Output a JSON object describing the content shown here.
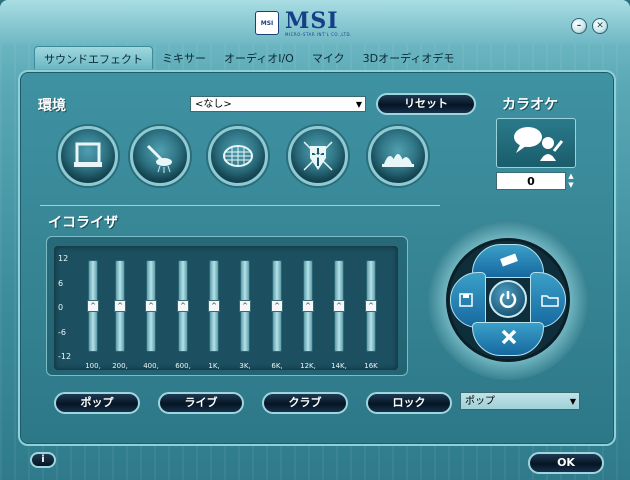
{
  "window": {
    "logo_main": "MSI",
    "logo_small": "MSI",
    "logo_sub": "MICRO-STAR INT'L CO.,LTD.",
    "minimize_label": "–",
    "close_label": "✕"
  },
  "tabs": [
    {
      "label": "サウンドエフェクト",
      "active": true
    },
    {
      "label": "ミキサー",
      "active": false
    },
    {
      "label": "オーディオI/O",
      "active": false
    },
    {
      "label": "マイク",
      "active": false
    },
    {
      "label": "3Dオーディオデモ",
      "active": false
    }
  ],
  "environment": {
    "label": "環境",
    "selected": "<なし>",
    "reset_label": "リセット",
    "icons": [
      "bathroom-icon",
      "shower-icon",
      "stadium-icon",
      "knight-icon",
      "opera-house-icon"
    ]
  },
  "karaoke": {
    "label": "カラオケ",
    "value": "0"
  },
  "equalizer": {
    "label": "イコライザ",
    "scale": [
      "12",
      "6",
      "0",
      "-6",
      "-12"
    ],
    "bands": [
      {
        "freq": "100,",
        "gain": 0
      },
      {
        "freq": "200,",
        "gain": 0
      },
      {
        "freq": "400,",
        "gain": 0
      },
      {
        "freq": "600,",
        "gain": 0
      },
      {
        "freq": "1K,",
        "gain": 0
      },
      {
        "freq": "3K,",
        "gain": 0
      },
      {
        "freq": "6K,",
        "gain": 0
      },
      {
        "freq": "12K,",
        "gain": 0
      },
      {
        "freq": "14K,",
        "gain": 0
      },
      {
        "freq": "16K",
        "gain": 0
      }
    ],
    "presets": [
      "ポップ",
      "ライブ",
      "クラブ",
      "ロック"
    ],
    "preset_selected": "ポップ"
  },
  "footer": {
    "info_label": "i",
    "ok_label": "OK"
  },
  "colors": {
    "panel": "#2d7888",
    "accent": "#9fd6de",
    "button_dark": "#051524"
  }
}
